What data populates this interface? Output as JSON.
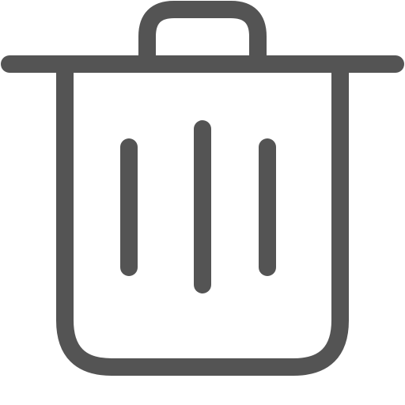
{
  "icon": {
    "name": "trash-icon",
    "color": "#545454",
    "background": "#ffffff"
  }
}
